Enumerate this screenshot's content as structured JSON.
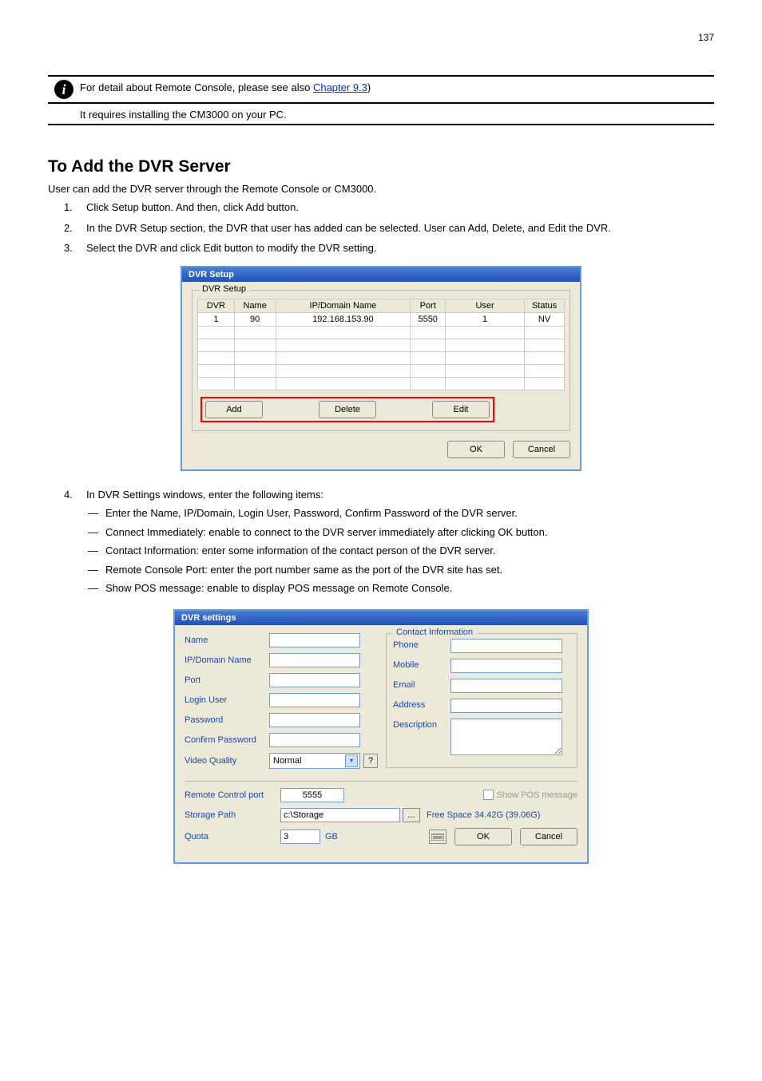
{
  "page_number_top": "137",
  "hyperlink_text": "Chapter 9.3",
  "info_note_prefix": "For detail about Remote Console, please see also ",
  "info_note_suffix": ")",
  "info_note2": "It requires installing the CM3000 on your PC.",
  "heading": "To Add the DVR Server",
  "intro": "User can add the DVR server through the Remote Console or CM3000.",
  "steps": {
    "s1": "Click Setup button. And then, click Add button.",
    "s2": "In the DVR Setup section, the DVR that user has added can be selected. User can Add, Delete, and Edit the DVR.",
    "s3": "Select the DVR and click Edit button to modify the DVR setting.",
    "s4": "In DVR Settings windows, enter the following items:",
    "s4_items": [
      "Enter the Name, IP/Domain, Login User, Password, Confirm Password of the DVR server.",
      "Connect Immediately: enable to connect to the DVR server immediately after clicking OK button.",
      "Contact Information: enter some information of the contact person of the DVR server.",
      "Remote Console Port: enter the port number same as the port of the DVR site has set.",
      "Show POS message: enable to display POS message on Remote Console."
    ]
  },
  "setup_dialog": {
    "title": "DVR Setup",
    "legend": "DVR Setup",
    "columns": {
      "dvr": "DVR",
      "name": "Name",
      "ip": "IP/Domain Name",
      "port": "Port",
      "user": "User",
      "status": "Status"
    },
    "row": {
      "dvr": "1",
      "name": "90",
      "ip": "192.168.153.90",
      "port": "5550",
      "user": "1",
      "status": "NV"
    },
    "buttons": {
      "add": "Add",
      "delete": "Delete",
      "edit": "Edit",
      "ok": "OK",
      "cancel": "Cancel"
    }
  },
  "settings_dialog": {
    "title": "DVR settings",
    "labels": {
      "name": "Name",
      "ip": "IP/Domain Name",
      "port": "Port",
      "login_user": "Login User",
      "password": "Password",
      "confirm_password": "Confirm Password",
      "video_quality": "Video Quality",
      "remote_control_port": "Remote Control port",
      "storage_path": "Storage Path",
      "quota": "Quota",
      "gb": "GB"
    },
    "values": {
      "video_quality": "Normal",
      "remote_control_port": "5555",
      "storage_path": "c:\\Storage",
      "quota": "3",
      "free_space": "Free Space 34.42G (39.06G)"
    },
    "contact": {
      "legend": "Contact Information",
      "phone": "Phone",
      "mobile": "Mobile",
      "email": "Email",
      "address": "Address",
      "description": "Description"
    },
    "show_pos": "Show POS message",
    "browse": "...",
    "help": "?",
    "buttons": {
      "ok": "OK",
      "cancel": "Cancel"
    }
  }
}
